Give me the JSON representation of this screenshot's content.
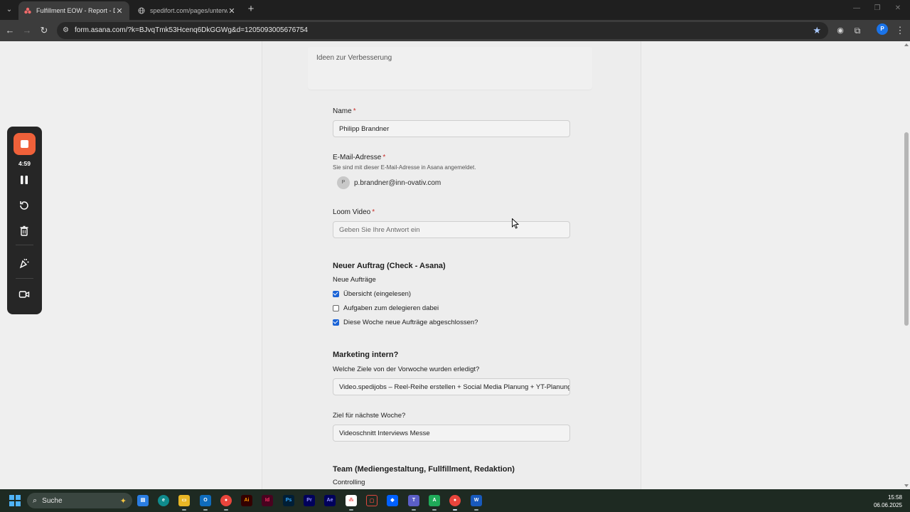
{
  "browser": {
    "tabs": [
      {
        "title": "Fulfillment EOW - Report - Die",
        "active": true
      },
      {
        "title": "spedifort.com/pages/unterwei",
        "active": false
      }
    ],
    "url": "form.asana.com/?k=BJvqTmk53Hcenq6DkGGWg&d=1205093005676754",
    "profile_initial": "P"
  },
  "recorder": {
    "timer": "4:59",
    "icons": [
      "stop-icon",
      "pause-icon",
      "restart-icon",
      "trash-icon",
      "confetti-icon",
      "camera-icon"
    ],
    "accent": "#f0613a"
  },
  "form": {
    "previous_field_placeholder": "Ideen zur Verbesserung",
    "name": {
      "label": "Name",
      "required": "*",
      "value": "Philipp Brandner"
    },
    "email": {
      "label": "E-Mail-Adresse",
      "required": "*",
      "hint": "Sie sind mit dieser E-Mail-Adresse in Asana angemeldet.",
      "avatar_initial": "P",
      "value": "p.brandner@inn-ovativ.com"
    },
    "loom": {
      "label": "Loom Video",
      "required": "*",
      "placeholder": "Geben Sie Ihre Antwort ein"
    },
    "section_neuer_auftrag": {
      "title": "Neuer Auftrag (Check - Asana)",
      "subtitle": "Neue Aufträge",
      "options": [
        {
          "label": "Übersicht (eingelesen)",
          "checked": true
        },
        {
          "label": "Aufgaben zum delegieren dabei",
          "checked": false
        },
        {
          "label": "Diese Woche neue Aufträge abgeschlossen?",
          "checked": true
        }
      ]
    },
    "section_marketing": {
      "title": "Marketing intern?",
      "q1_label": "Welche Ziele von der Vorwoche wurden erledigt?",
      "q1_value": "Video.spedijobs – Reel-Reihe erstellen + Social Media Planung + YT-Planung.",
      "q2_label": "Ziel für nächste Woche?",
      "q2_value": "Videoschnitt Interviews Messe"
    },
    "section_team": {
      "title": "Team (Mediengestaltung, Fullfillment, Redaktion)",
      "subtitle": "Controlling"
    }
  },
  "taskbar": {
    "search_label": "Suche",
    "time": "15:58",
    "date": "06.06.2025",
    "apps": [
      "file-explorer",
      "edge",
      "folder",
      "outlook",
      "chrome",
      "illustrator",
      "indesign",
      "photoshop",
      "premiere",
      "after-effects",
      "asana",
      "app-red",
      "dropbox",
      "teams",
      "app-green",
      "chrome-profile",
      "word"
    ]
  },
  "colors": {
    "checkbox_checked": "#1a63d6",
    "required": "#c9302c",
    "chrome_dark": "#1f1f1f"
  }
}
